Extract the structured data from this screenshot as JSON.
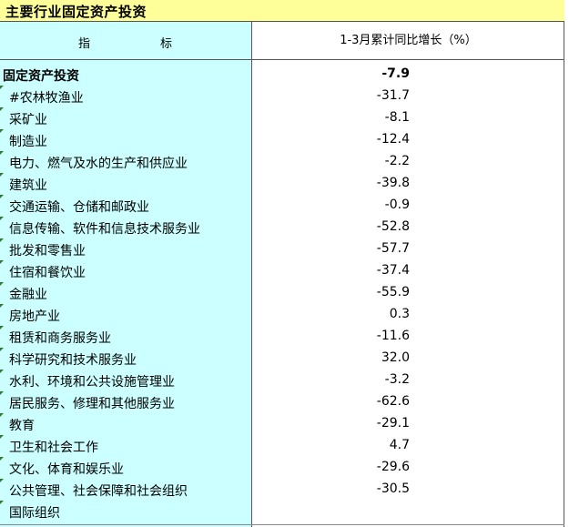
{
  "title": "主要行业固定资产投资",
  "header": {
    "indicator_char1": "指",
    "indicator_char2": "标",
    "growth_label": "1-3月累计同比增长（%）"
  },
  "rows": [
    {
      "name": "固定资产投资",
      "value": "-7.9"
    },
    {
      "name": "#农林牧渔业",
      "value": "-31.7"
    },
    {
      "name": "采矿业",
      "value": "-8.1"
    },
    {
      "name": "制造业",
      "value": "-12.4"
    },
    {
      "name": "电力、燃气及水的生产和供应业",
      "value": "-2.2"
    },
    {
      "name": "建筑业",
      "value": "-39.8"
    },
    {
      "name": "交通运输、仓储和邮政业",
      "value": "-0.9"
    },
    {
      "name": "信息传输、软件和信息技术服务业",
      "value": "-52.8"
    },
    {
      "name": "批发和零售业",
      "value": "-57.7"
    },
    {
      "name": "住宿和餐饮业",
      "value": "-37.4"
    },
    {
      "name": "金融业",
      "value": "-55.9"
    },
    {
      "name": "房地产业",
      "value": "0.3"
    },
    {
      "name": "租赁和商务服务业",
      "value": "-11.6"
    },
    {
      "name": "科学研究和技术服务业",
      "value": "32.0"
    },
    {
      "name": "水利、环境和公共设施管理业",
      "value": "-3.2"
    },
    {
      "name": "居民服务、修理和其他服务业",
      "value": "-62.6"
    },
    {
      "name": "教育",
      "value": "-29.1"
    },
    {
      "name": "卫生和社会工作",
      "value": "4.7"
    },
    {
      "name": "文化、体育和娱乐业",
      "value": "-29.6"
    },
    {
      "name": "公共管理、社会保障和社会组织",
      "value": "-30.5"
    },
    {
      "name": "国际组织",
      "value": ""
    }
  ],
  "colors": {
    "title_bg": "#ffff99",
    "label_bg": "#ccffff",
    "marker": "#2e7d32"
  }
}
